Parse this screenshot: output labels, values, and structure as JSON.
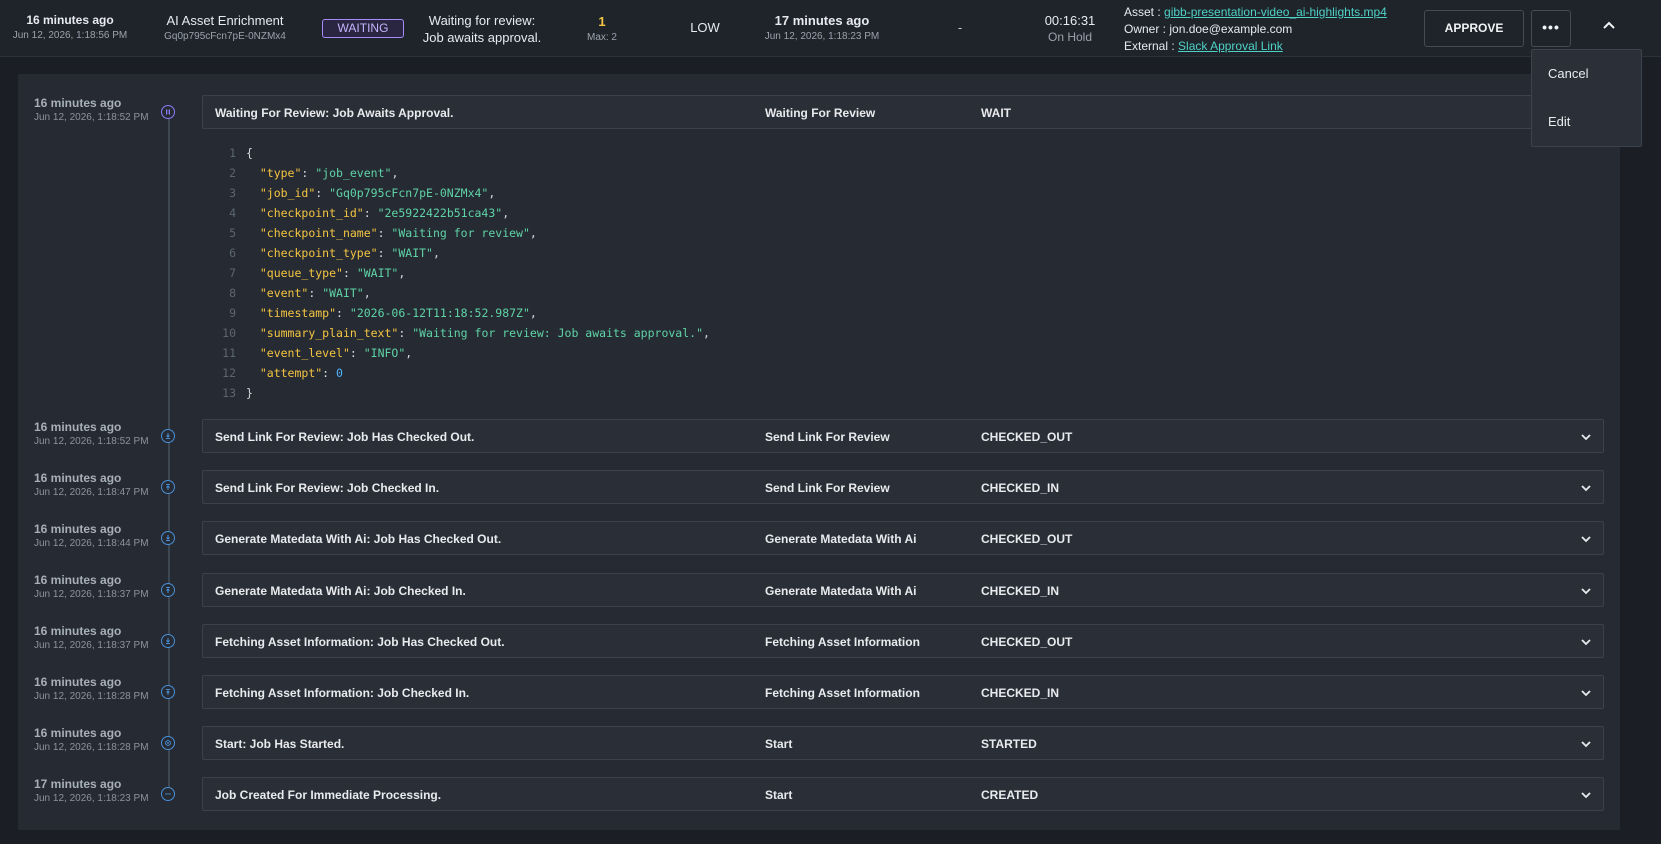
{
  "header": {
    "created_rel": "16 minutes ago",
    "created_abs": "Jun 12, 2026, 1:18:56 PM",
    "job_name": "AI Asset Enrichment",
    "job_id": "Gq0p795cFcn7pE-0NZMx4",
    "status": "WAITING",
    "status_line1": "Waiting for review:",
    "status_line2": "Job awaits approval.",
    "attempt": "1",
    "attempt_max": "Max: 2",
    "priority": "LOW",
    "updated_rel": "17 minutes ago",
    "updated_abs": "Jun 12, 2026, 1:18:23 PM",
    "dash": "-",
    "duration": "00:16:31",
    "duration_state": "On Hold",
    "asset_label": "Asset :",
    "asset_link": "gibb-presentation-video_ai-highlights.mp4",
    "owner_label": "Owner :",
    "owner_value": "jon.doe@example.com",
    "external_label": "External :",
    "external_link": "Slack Approval Link",
    "approve_label": "APPROVE",
    "more_label": "•••"
  },
  "dropdown": {
    "items": [
      "Cancel",
      "Edit"
    ]
  },
  "colors": {
    "accent_teal": "#4fd1c5",
    "waiting_purple": "#a78bfa",
    "attempt_yellow": "#f4c542"
  },
  "events": [
    {
      "time_rel": "16 minutes ago",
      "time_abs": "Jun 12, 2026, 1:18:52 PM",
      "icon": "pause-icon",
      "summary": "Waiting For Review: Job Awaits Approval.",
      "checkpoint": "Waiting For Review",
      "type": "WAIT",
      "expanded": true
    },
    {
      "time_rel": "16 minutes ago",
      "time_abs": "Jun 12, 2026, 1:18:52 PM",
      "icon": "checkout-icon",
      "summary": "Send Link For Review: Job Has Checked Out.",
      "checkpoint": "Send Link For Review",
      "type": "CHECKED_OUT"
    },
    {
      "time_rel": "16 minutes ago",
      "time_abs": "Jun 12, 2026, 1:18:47 PM",
      "icon": "checkin-icon",
      "summary": "Send Link For Review: Job Checked In.",
      "checkpoint": "Send Link For Review",
      "type": "CHECKED_IN"
    },
    {
      "time_rel": "16 minutes ago",
      "time_abs": "Jun 12, 2026, 1:18:44 PM",
      "icon": "checkout-icon",
      "summary": "Generate Matedata With Ai: Job Has Checked Out.",
      "checkpoint": "Generate Matedata With Ai",
      "type": "CHECKED_OUT"
    },
    {
      "time_rel": "16 minutes ago",
      "time_abs": "Jun 12, 2026, 1:18:37 PM",
      "icon": "checkin-icon",
      "summary": "Generate Matedata With Ai: Job Checked In.",
      "checkpoint": "Generate Matedata With Ai",
      "type": "CHECKED_IN"
    },
    {
      "time_rel": "16 minutes ago",
      "time_abs": "Jun 12, 2026, 1:18:37 PM",
      "icon": "checkout-icon",
      "summary": "Fetching Asset Information: Job Has Checked Out.",
      "checkpoint": "Fetching Asset Information",
      "type": "CHECKED_OUT"
    },
    {
      "time_rel": "16 minutes ago",
      "time_abs": "Jun 12, 2026, 1:18:28 PM",
      "icon": "checkin-icon",
      "summary": "Fetching Asset Information: Job Checked In.",
      "checkpoint": "Fetching Asset Information",
      "type": "CHECKED_IN"
    },
    {
      "time_rel": "16 minutes ago",
      "time_abs": "Jun 12, 2026, 1:18:28 PM",
      "icon": "start-icon",
      "summary": "Start: Job Has Started.",
      "checkpoint": "Start",
      "type": "STARTED"
    },
    {
      "time_rel": "17 minutes ago",
      "time_abs": "Jun 12, 2026, 1:18:23 PM",
      "icon": "created-icon",
      "summary": "Job Created For Immediate Processing.",
      "checkpoint": "Start",
      "type": "CREATED"
    }
  ],
  "event_json": [
    {
      "ln": "1",
      "t": "{"
    },
    {
      "ln": "2",
      "k": "\"type\"",
      "v": "\"job_event\"",
      "vt": "s",
      "c": ","
    },
    {
      "ln": "3",
      "k": "\"job_id\"",
      "v": "\"Gq0p795cFcn7pE-0NZMx4\"",
      "vt": "s",
      "c": ","
    },
    {
      "ln": "4",
      "k": "\"checkpoint_id\"",
      "v": "\"2e5922422b51ca43\"",
      "vt": "s",
      "c": ","
    },
    {
      "ln": "5",
      "k": "\"checkpoint_name\"",
      "v": "\"Waiting for review\"",
      "vt": "s",
      "c": ","
    },
    {
      "ln": "6",
      "k": "\"checkpoint_type\"",
      "v": "\"WAIT\"",
      "vt": "s",
      "c": ","
    },
    {
      "ln": "7",
      "k": "\"queue_type\"",
      "v": "\"WAIT\"",
      "vt": "s",
      "c": ","
    },
    {
      "ln": "8",
      "k": "\"event\"",
      "v": "\"WAIT\"",
      "vt": "s",
      "c": ","
    },
    {
      "ln": "9",
      "k": "\"timestamp\"",
      "v": "\"2026-06-12T11:18:52.987Z\"",
      "vt": "s",
      "c": ","
    },
    {
      "ln": "10",
      "k": "\"summary_plain_text\"",
      "v": "\"Waiting for review: Job awaits approval.\"",
      "vt": "s",
      "c": ","
    },
    {
      "ln": "11",
      "k": "\"event_level\"",
      "v": "\"INFO\"",
      "vt": "s",
      "c": ","
    },
    {
      "ln": "12",
      "k": "\"attempt\"",
      "v": "0",
      "vt": "n",
      "c": ""
    },
    {
      "ln": "13",
      "t": "}"
    }
  ]
}
